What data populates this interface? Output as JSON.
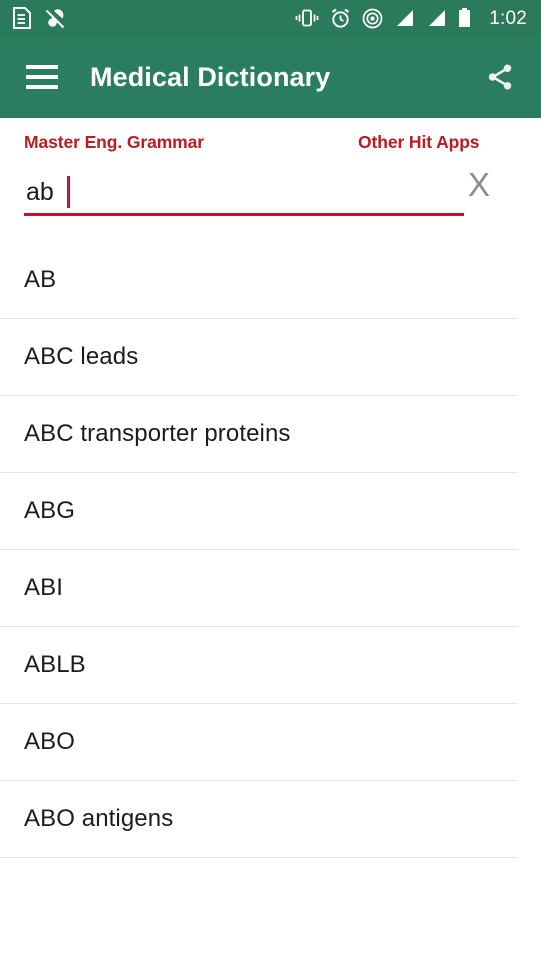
{
  "status_bar": {
    "time": "1:02",
    "left_icons": [
      "document-icon",
      "sound-muted-icon"
    ],
    "right_icons": [
      "vibrate-icon",
      "alarm-clock-icon",
      "hotspot-icon",
      "signal-bars-icon",
      "signal-bars-icon-2",
      "battery-icon"
    ],
    "background_color": "#2a7a5b"
  },
  "app_bar": {
    "menu_icon": "hamburger-menu-icon",
    "title": "Medical Dictionary",
    "share_icon": "share-icon",
    "background_color": "#2a7d5e",
    "text_color": "#ffffff"
  },
  "promo": {
    "left_label": "Master Eng. Grammar",
    "right_label": "Other Hit Apps",
    "color": "#b81d22"
  },
  "search": {
    "value": "ab",
    "placeholder": "",
    "clear_label": "X",
    "underline_color": "#c8102e",
    "caret_color": "#c8102e"
  },
  "results": [
    {
      "label": "AB"
    },
    {
      "label": "ABC leads"
    },
    {
      "label": "ABC transporter proteins"
    },
    {
      "label": "ABG"
    },
    {
      "label": "ABI"
    },
    {
      "label": "ABLB"
    },
    {
      "label": "ABO"
    },
    {
      "label": "ABO antigens"
    }
  ]
}
